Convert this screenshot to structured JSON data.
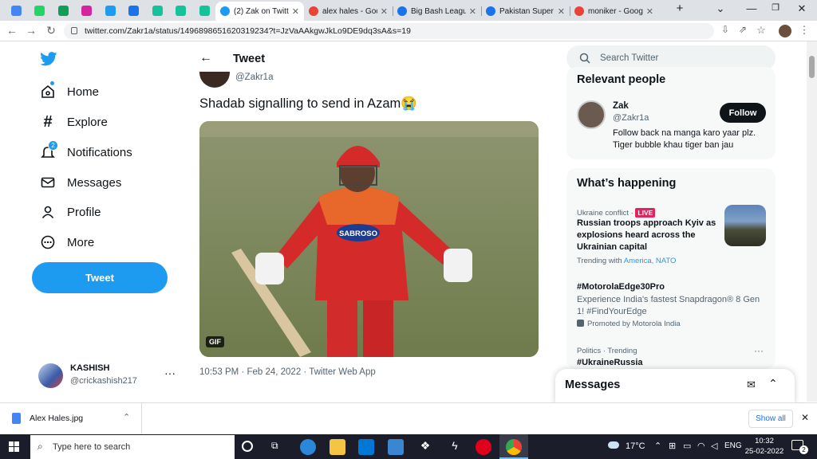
{
  "browser": {
    "pinned_tabs": [
      {
        "icon": "docs-icon",
        "color": "#4285f4",
        "glyph": "≡"
      },
      {
        "icon": "whatsapp-icon",
        "color": "#25d366",
        "glyph": "✆"
      },
      {
        "icon": "sheets-plus-icon",
        "color": "#0f9d58",
        "glyph": "+"
      },
      {
        "icon": "instagram-icon",
        "color": "#d6249f",
        "glyph": "◎"
      },
      {
        "icon": "twitter-icon",
        "color": "#1d9bf0",
        "glyph": "🐦"
      },
      {
        "icon": "cricinfo-icon",
        "color": "#1a73e8",
        "glyph": "S"
      },
      {
        "icon": "grammarly-icon",
        "color": "#15c39a",
        "glyph": "G"
      },
      {
        "icon": "grammarly-icon",
        "color": "#15c39a",
        "glyph": "G"
      },
      {
        "icon": "grammarly-icon",
        "color": "#15c39a",
        "glyph": "G"
      }
    ],
    "tabs": [
      {
        "title": "(2) Zak on Twitte",
        "icon": "twitter-icon",
        "color": "#1d9bf0",
        "active": true
      },
      {
        "title": "alex hales - Goo",
        "icon": "google-icon",
        "color": "#ea4335",
        "active": false
      },
      {
        "title": "Big Bash League",
        "icon": "globe-icon",
        "color": "#1a73e8",
        "active": false
      },
      {
        "title": "Pakistan Super L",
        "icon": "globe-icon",
        "color": "#1a73e8",
        "active": false
      },
      {
        "title": "moniker - Googl",
        "icon": "google-icon",
        "color": "#ea4335",
        "active": false
      }
    ],
    "new_tab": "+",
    "url": "twitter.com/Zakr1a/status/1496898651620319234?t=JzVaAAkgwJkLo9DE9dq3sA&s=19"
  },
  "nav": {
    "items": [
      {
        "label": "Home",
        "icon": "home-icon"
      },
      {
        "label": "Explore",
        "icon": "hashtag-icon"
      },
      {
        "label": "Notifications",
        "icon": "bell-icon",
        "badge": "2"
      },
      {
        "label": "Messages",
        "icon": "mail-icon"
      },
      {
        "label": "Profile",
        "icon": "person-icon"
      },
      {
        "label": "More",
        "icon": "more-circle-icon"
      }
    ],
    "tweet_button": "Tweet"
  },
  "account": {
    "name": "KASHISH",
    "handle": "@crickashish217",
    "more": "···"
  },
  "tweet": {
    "header": "Tweet",
    "handle": "@Zakr1a",
    "text": "Shadab signalling to send in Azam😭",
    "gif_badge": "GIF",
    "jersey_sponsor": "SABROSO",
    "meta": "10:53 PM · Feb 24, 2022 · Twitter Web App"
  },
  "right": {
    "search_placeholder": "Search Twitter",
    "relevant": {
      "title": "Relevant people",
      "name": "Zak",
      "handle": "@Zakr1a",
      "bio": "Follow back na manga karo yaar plz. Tiger bubble khau tiger ban jau",
      "follow": "Follow"
    },
    "happening": {
      "title": "What’s happening",
      "items": [
        {
          "context": "Ukraine conflict · ",
          "live": "LIVE",
          "headline": "Russian troops approach Kyiv as explosions heard across the Ukrainian capital",
          "trending_label": "Trending with ",
          "trending_with": "America, NATO"
        },
        {
          "headline": "#MotorolaEdge30Pro",
          "desc": "Experience India's fastest Snapdragon® 8 Gen 1! #FindYourEdge",
          "promo": "Promoted by Motorola India"
        },
        {
          "context": "Politics · Trending",
          "headline": "#UkraineRussia",
          "more": "···"
        }
      ]
    },
    "messages_drawer": "Messages"
  },
  "download": {
    "file": "Alex Hales.jpg",
    "show_all": "Show all"
  },
  "taskbar": {
    "search_placeholder": "Type here to search",
    "weather": "17°C",
    "lang": "ENG",
    "time": "10:32",
    "date": "25-02-2022",
    "notif_count": "2"
  }
}
